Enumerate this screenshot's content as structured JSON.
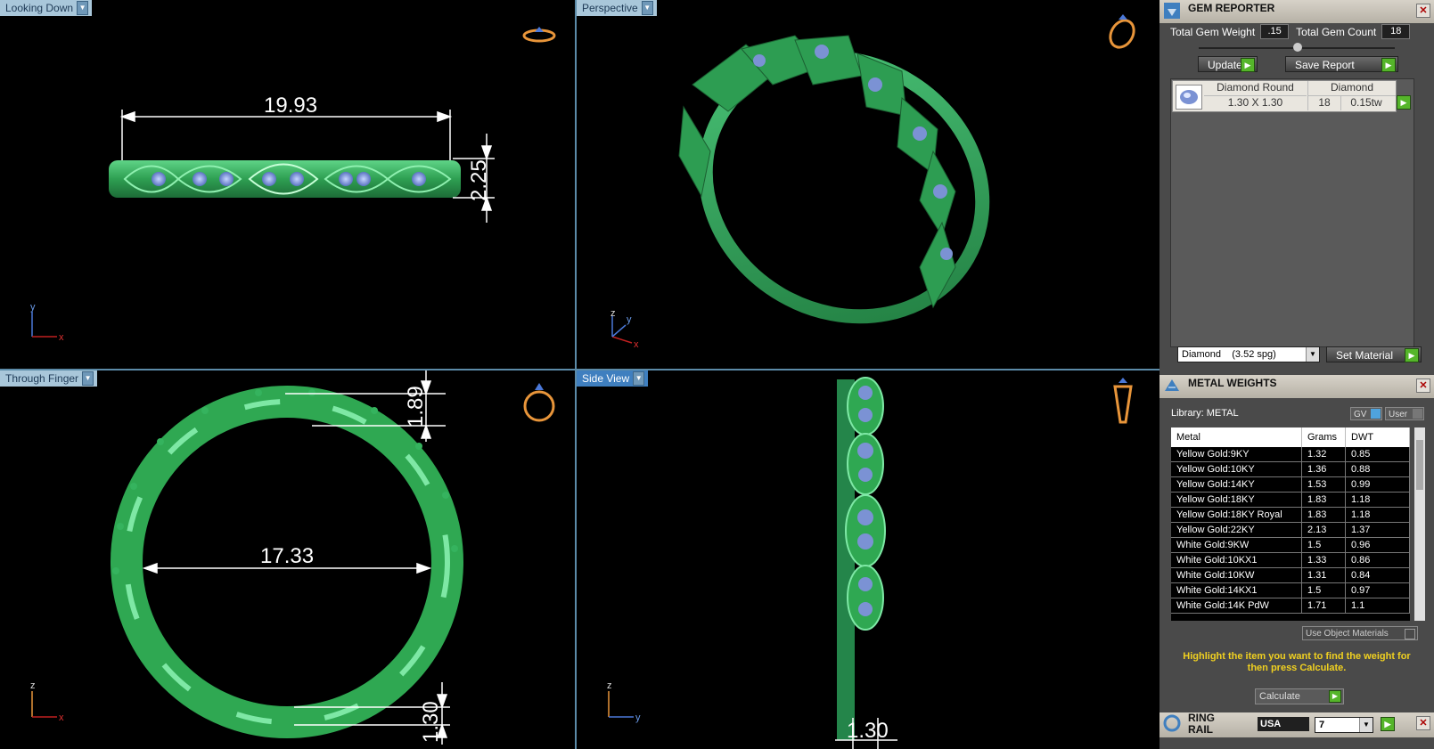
{
  "viewports": {
    "top_left": {
      "label": "Looking Down",
      "dim_width": "19.93",
      "dim_height": "2.25",
      "axis_v": "y",
      "axis_h": "x"
    },
    "top_right": {
      "label": "Perspective",
      "axis_v": "z",
      "axis_h": "x",
      "axis_d": "y"
    },
    "bottom_left": {
      "label": "Through Finger",
      "dim_inner": "17.33",
      "dim_top": "1.89",
      "dim_bottom": "1.30",
      "axis_v": "z",
      "axis_h": "x"
    },
    "bottom_right": {
      "label": "Side View",
      "dim_bottom": "1.30",
      "axis_v": "z",
      "axis_h": "y"
    }
  },
  "gem_reporter": {
    "title": "GEM REPORTER",
    "total_gem_weight_label": "Total Gem Weight",
    "total_gem_weight_value": ".15",
    "total_gem_count_label": "Total Gem Count",
    "total_gem_count_value": "18",
    "update_label": "Update",
    "save_report_label": "Save Report",
    "gem_row": {
      "name": "Diamond Round",
      "size": "1.30 X 1.30",
      "material": "Diamond",
      "count": "18",
      "weight": "0.15tw"
    },
    "material_select": "Diamond    (3.52 spg)",
    "set_material_label": "Set Material"
  },
  "metal_weights": {
    "title": "METAL WEIGHTS",
    "library_label": "Library: METAL",
    "gv_label": "GV",
    "user_label": "User",
    "columns": [
      "Metal",
      "Grams",
      "DWT"
    ],
    "rows": [
      [
        "Yellow Gold:9KY",
        "1.32",
        "0.85"
      ],
      [
        "Yellow Gold:10KY",
        "1.36",
        "0.88"
      ],
      [
        "Yellow Gold:14KY",
        "1.53",
        "0.99"
      ],
      [
        "Yellow Gold:18KY",
        "1.83",
        "1.18"
      ],
      [
        "Yellow Gold:18KY Royal",
        "1.83",
        "1.18"
      ],
      [
        "Yellow Gold:22KY",
        "2.13",
        "1.37"
      ],
      [
        "White Gold:9KW",
        "1.5",
        "0.96"
      ],
      [
        "White Gold:10KX1",
        "1.33",
        "0.86"
      ],
      [
        "White Gold:10KW",
        "1.31",
        "0.84"
      ],
      [
        "White Gold:14KX1",
        "1.5",
        "0.97"
      ],
      [
        "White Gold:14K PdW",
        "1.71",
        "1.1"
      ]
    ],
    "use_object_materials_label": "Use Object Materials",
    "hint": "Highlight the item you want to find the weight for then press Calculate.",
    "calculate_label": "Calculate"
  },
  "ring_rail": {
    "title": "RING RAIL",
    "country": "USA",
    "size": "7"
  },
  "colors": {
    "ring_green": "#2fa852",
    "gem_blue": "#7b92d4",
    "tab_bg": "#a9c7da",
    "highlight_yellow": "#f0d020"
  }
}
